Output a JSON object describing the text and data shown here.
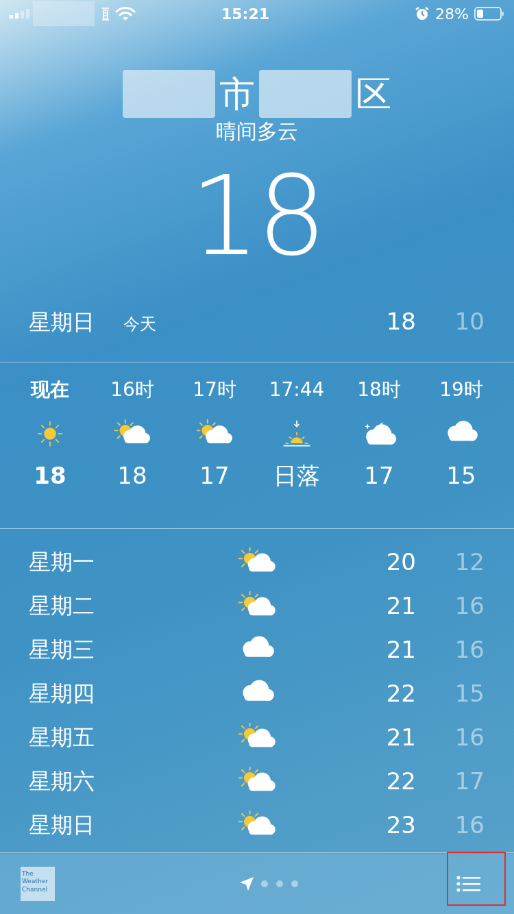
{
  "status_bar": {
    "time": "15:21",
    "battery_percent": "28%"
  },
  "location": {
    "parts": [
      {
        "kind": "masked"
      },
      {
        "kind": "text",
        "text": "市"
      },
      {
        "kind": "masked"
      },
      {
        "kind": "text",
        "text": "区"
      }
    ],
    "condition": "晴间多云",
    "temperature": "18"
  },
  "today": {
    "day": "星期日",
    "label": "今天",
    "high": "18",
    "low": "10"
  },
  "hourly": [
    {
      "time": "现在",
      "kind": "sun",
      "value": "18",
      "current": true
    },
    {
      "time": "16时",
      "kind": "partly-cloudy",
      "value": "18",
      "current": false
    },
    {
      "time": "17时",
      "kind": "partly-cloudy",
      "value": "17",
      "current": false
    },
    {
      "time": "17:44",
      "kind": "sunset",
      "value": "日落",
      "current": false
    },
    {
      "time": "18时",
      "kind": "night-partly-cloudy",
      "value": "17",
      "current": false
    },
    {
      "time": "19时",
      "kind": "cloudy",
      "value": "15",
      "current": false
    }
  ],
  "daily": [
    {
      "day": "星期一",
      "kind": "partly-cloudy",
      "high": "20",
      "low": "12"
    },
    {
      "day": "星期二",
      "kind": "partly-cloudy",
      "high": "21",
      "low": "16"
    },
    {
      "day": "星期三",
      "kind": "cloudy",
      "high": "21",
      "low": "16"
    },
    {
      "day": "星期四",
      "kind": "cloudy",
      "high": "22",
      "low": "15"
    },
    {
      "day": "星期五",
      "kind": "partly-cloudy",
      "high": "21",
      "low": "16"
    },
    {
      "day": "星期六",
      "kind": "partly-cloudy",
      "high": "22",
      "low": "17"
    },
    {
      "day": "星期日",
      "kind": "partly-cloudy",
      "high": "23",
      "low": "16"
    }
  ],
  "bottom_bar": {
    "logo_lines": [
      "The",
      "Weather",
      "Channel"
    ],
    "pages": [
      {
        "kind": "location",
        "selected": true
      },
      {
        "kind": "dot",
        "selected": false
      },
      {
        "kind": "dot",
        "selected": false
      },
      {
        "kind": "dot",
        "selected": false
      }
    ],
    "highlight_frame": true
  }
}
